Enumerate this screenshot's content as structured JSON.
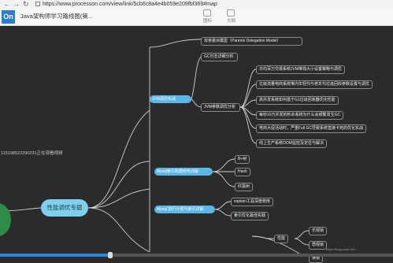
{
  "browser": {
    "back_icon": "back-arrow-icon",
    "forward_icon": "forward-arrow-icon",
    "refresh_icon": "refresh-icon",
    "url": "https://www.processon.com/view/link/5cb6c8a4e4b059e209fbf369#map"
  },
  "app": {
    "logo_text": "On",
    "title": "Java架构师学习路线图(第...",
    "tools": [
      {
        "label": "图标",
        "icon": "image-icon"
      },
      {
        "label": "大纲",
        "icon": "outline-icon"
      }
    ]
  },
  "mindmap": {
    "root": "性能调优专题",
    "watching": "115198522290231正在观看视频",
    "parents_delegation": "双亲委派模型（Parents Delegation Model）",
    "jvm_branch": "JVM调优实战",
    "gc_log": "GC日志详细分析",
    "jvm_params": "JVM参数调优分析",
    "jvm_items": [
      "日均百万交易系统JVM堆栈大小设置策略与调优",
      "亿级流量电商系统堆内年轻代与老年代垃圾回收参数设置与调优",
      "高并发系统如何基于G1垃圾回收器优化性能",
      "每秒10万并发的秒杀系统为什么会频繁发生GC",
      "电商大促活动时，严重Full GC导致系统直接卡死的优化实战",
      "线上生产系统OOM监控及定位与解决"
    ],
    "mysql_index": "Mysql索引数据结构详解",
    "mysql_index_items": [
      "B+树",
      "Hash",
      "红黑树"
    ],
    "mysql_explain": "Mysql 执行计划与索引详解",
    "mysql_explain_items": [
      "explain工具深度使用",
      "索引优化最佳实践"
    ],
    "perf": "性能",
    "perf_items": [
      "乐观锁",
      "悲观锁"
    ],
    "bottom_item": "读锁"
  },
  "player": {
    "progress": 0.28,
    "status_text": "https://blog.csdn.net/..."
  },
  "colors": {
    "background": "#2b2b2b",
    "blue_node": "#5bb6e8",
    "root": "#7fd0ea",
    "line": "#cfcfcf"
  }
}
